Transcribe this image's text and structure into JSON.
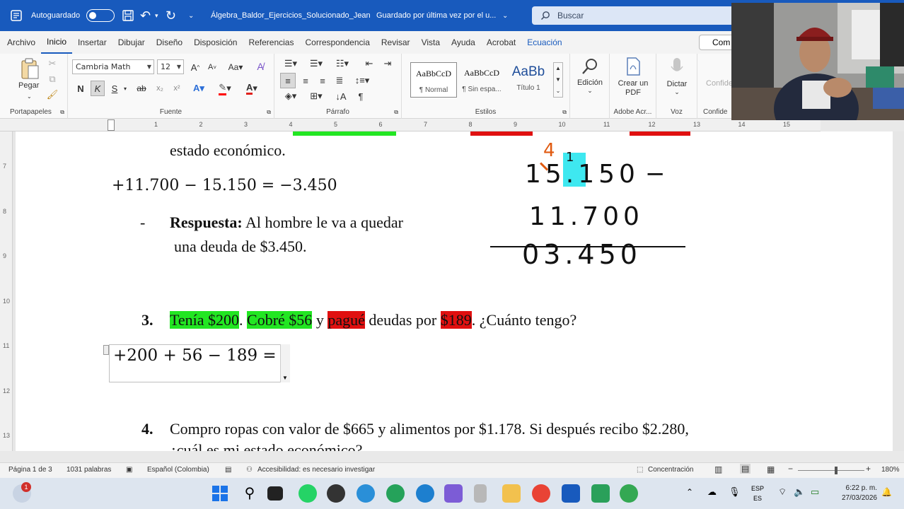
{
  "titlebar": {
    "autosave_label": "Autoguardado",
    "doc_title": "Álgebra_Baldor_Ejercicios_Solucionado_Jean",
    "save_status": "Guardado por última vez por el u...",
    "search_placeholder": "Buscar"
  },
  "menu": {
    "tabs": [
      "Archivo",
      "Inicio",
      "Insertar",
      "Dibujar",
      "Diseño",
      "Disposición",
      "Referencias",
      "Correspondencia",
      "Revisar",
      "Vista",
      "Ayuda",
      "Acrobat",
      "Ecuación"
    ],
    "comment_label": "Com"
  },
  "ribbon": {
    "clipboard": {
      "paste_label": "Pegar",
      "group_label": "Portapapeles"
    },
    "font": {
      "family": "Cambria Math",
      "size": "12",
      "bold": "N",
      "italic": "K",
      "underline": "S",
      "strike": "ab",
      "sub": "x₂",
      "sup": "x²",
      "group_label": "Fuente"
    },
    "paragraph": {
      "group_label": "Párrafo"
    },
    "styles": {
      "tiles": [
        {
          "preview": "AaBbCcD",
          "name": "¶ Normal"
        },
        {
          "preview": "AaBbCcD",
          "name": "¶ Sin espa..."
        },
        {
          "preview": "AaBb",
          "name": "Título 1"
        }
      ],
      "group_label": "Estilos"
    },
    "edicion_label": "Edición",
    "adobe": {
      "button_label": "Crear un PDF",
      "group_label": "Adobe Acr..."
    },
    "voz": {
      "button_label": "Dictar",
      "group_label": "Voz"
    },
    "conf": {
      "button_label": "Confide",
      "group_label": "Confide"
    }
  },
  "ruler": {
    "numbers": [
      "1",
      "2",
      "3",
      "4",
      "5",
      "6",
      "7",
      "8",
      "9",
      "10",
      "11",
      "12",
      "13",
      "14",
      "15"
    ]
  },
  "vruler": {
    "numbers": [
      "7",
      "8",
      "9",
      "10",
      "11",
      "12",
      "13"
    ]
  },
  "document": {
    "line1": "estado económico.",
    "eq1": "+11.700 − 15.150 = −3.450",
    "bullet": "-",
    "answer_label": "Respuesta:",
    "answer_text": " Al hombre le va a quedar",
    "answer_text2": "una deuda de $3.450.",
    "handwriting": {
      "carry_top": "4",
      "row1": "15.150",
      "row1_borrow": "1",
      "minus": "−",
      "row2": "11.700",
      "row3": "03.450"
    },
    "item3": {
      "number": "3.",
      "p1": "Tenía $200",
      "p2": ". ",
      "p3": "Cobré $56",
      "p4": " y ",
      "p5": "pagué",
      "p6": " deudas por ",
      "p7": "$189",
      "p8": ". ¿Cuánto tengo?"
    },
    "eq2": "+200 + 56 − 189 =",
    "item4": {
      "number": "4.",
      "text": "Compro ropas con valor de $665 y alimentos por $1.178. Si después recibo $2.280,",
      "text2": "¿cuál es mi estado económico?"
    }
  },
  "statusbar": {
    "page": "Página 1 de 3",
    "words": "1031 palabras",
    "language": "Español (Colombia)",
    "accessibility": "Accesibilidad: es necesario investigar",
    "focus": "Concentración",
    "zoom": "180%"
  },
  "taskbar": {
    "badge": "1",
    "lang1": "ESP",
    "lang2": "ES",
    "time": "6:22 p. m.",
    "date": "27/03/2026"
  }
}
